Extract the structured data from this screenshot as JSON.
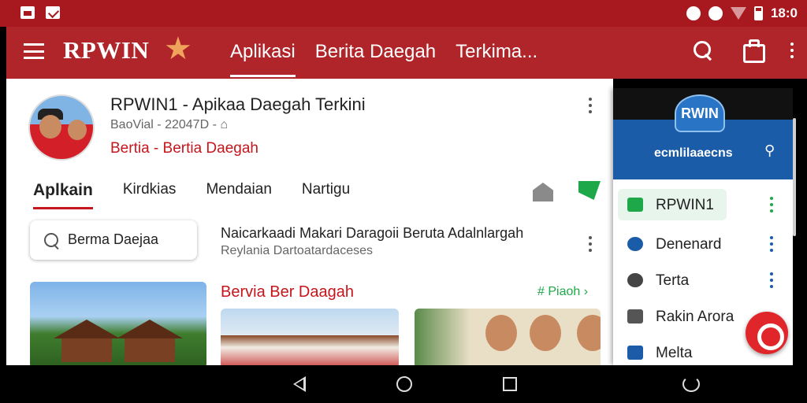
{
  "status_bar": {
    "time": "18:0"
  },
  "app_bar": {
    "brand": "RPWIN",
    "tabs": [
      {
        "label": "Aplikasi",
        "active": true
      },
      {
        "label": "Berita Daegah",
        "active": false
      },
      {
        "label": "Terkima...",
        "active": false
      }
    ]
  },
  "profile": {
    "title": "RPWIN1 - Apikaa Daegah Terkini",
    "subtitle": "BaoVial - 22047D -",
    "tagline": "Bertia - Bertia Daegah"
  },
  "subtabs": [
    {
      "label": "Aplkain",
      "active": true
    },
    {
      "label": "Kirdkias",
      "active": false
    },
    {
      "label": "Mendaian",
      "active": false
    },
    {
      "label": "Nartigu",
      "active": false
    }
  ],
  "search": {
    "value": "Berma Daejaa"
  },
  "news": {
    "title": "Naicarkaadi Makari Daragoii Beruta Adalnlargah",
    "subtitle": "Reylania Dartoatardaceses"
  },
  "section": {
    "title": "Bervia Ber Daagah",
    "link": "# Piaoh"
  },
  "drawer": {
    "logo": "RWIN",
    "header_text": "ecmlilaaecns",
    "items": [
      {
        "label": "RPWIN1",
        "icon": "play-icon",
        "color": "#1fa84a",
        "selected": true
      },
      {
        "label": "Denenard",
        "icon": "gear-icon",
        "color": "#1a5ca8",
        "selected": false
      },
      {
        "label": "Terta",
        "icon": "message-icon",
        "color": "#444444",
        "selected": false
      },
      {
        "label": "Rakin Arora",
        "icon": "edit-icon",
        "color": "#555555",
        "selected": false
      },
      {
        "label": "Melta",
        "icon": "folder-icon",
        "color": "#1a5ca8",
        "selected": false
      }
    ]
  },
  "colors": {
    "primary": "#b0252a",
    "accent_red": "#c4161c",
    "accent_green": "#1fa84a",
    "drawer_blue": "#1a5ca8"
  }
}
